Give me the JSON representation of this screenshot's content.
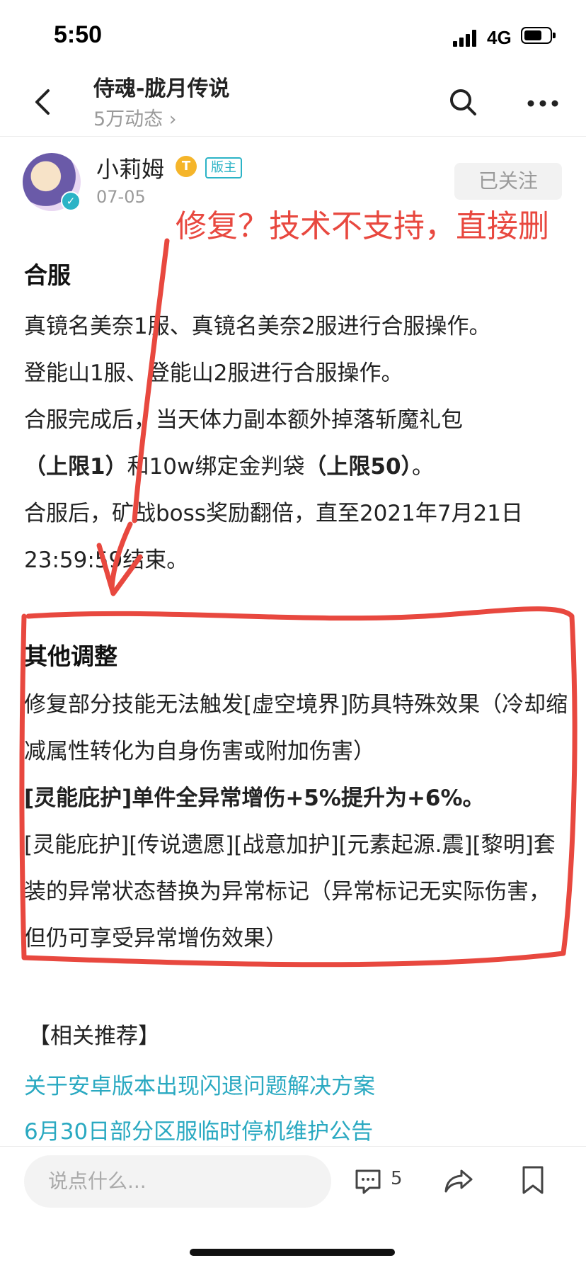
{
  "status_bar": {
    "time": "5:50",
    "network": "4G"
  },
  "header": {
    "title": "侍魂-胧月传说",
    "subtitle": "5万动态 ›"
  },
  "author": {
    "name": "小莉姆",
    "level_badge": "T",
    "role_badge": "版主",
    "date": "07-05",
    "follow_label": "已关注"
  },
  "annotation": {
    "text": "修复？技术不支持，直接删"
  },
  "post": {
    "section1_title": "合服",
    "p1": "真镜名美奈1服、真镜名美奈2服进行合服操作。",
    "p2": "登能山1服、登能山2服进行合服操作。",
    "p3a": "合服完成后，当天体力副本额外掉落斩魔礼包",
    "p3b_bold1": "（上限1）",
    "p3b_mid": "和10w绑定金判袋",
    "p3b_bold2": "（上限50）",
    "p3b_end": "。",
    "p4": "合服后，矿战boss奖励翻倍，直至2021年7月21日23:59:59结束。",
    "section2_title": "其他调整",
    "p5": "修复部分技能无法触发[虚空境界]防具特殊效果（冷却缩减属性转化为自身伤害或附加伤害）",
    "p6": "[灵能庇护]单件全异常增伤+5%提升为+6%。",
    "p7": "[灵能庇护][传说遗愿][战意加护][元素起源.震][黎明]套装的异常状态替换为异常标记（异常标记无实际伤害，但仍可享受异常增伤效果）",
    "related_title": "【相关推荐】",
    "related_links": [
      "关于安卓版本出现闪退问题解决方案",
      "6月30日部分区服临时停机维护公告"
    ]
  },
  "bottom_bar": {
    "input_placeholder": "说点什么...",
    "comment_count": "5"
  },
  "colors": {
    "accent": "#2aa9c1",
    "annotation": "#e8483f"
  }
}
